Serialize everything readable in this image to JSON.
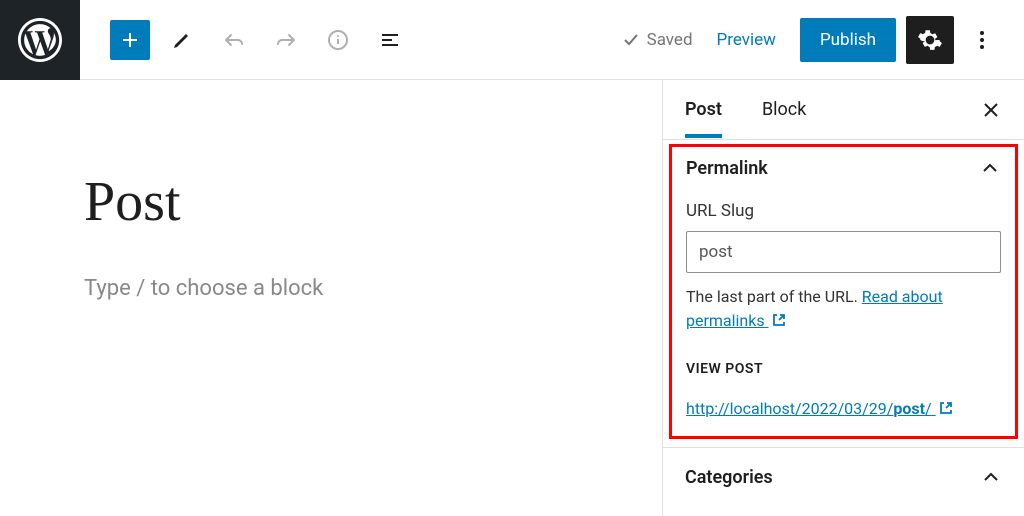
{
  "topbar": {
    "saved": "Saved",
    "preview": "Preview",
    "publish": "Publish"
  },
  "editor": {
    "title": "Post",
    "placeholder": "Type / to choose a block"
  },
  "tabs": {
    "post": "Post",
    "block": "Block"
  },
  "permalink": {
    "title": "Permalink",
    "slug_label": "URL Slug",
    "slug_value": "post",
    "help_prefix": "The last part of the URL. ",
    "help_link": "Read about permalinks",
    "view_label": "VIEW POST",
    "url_prefix": "http://localhost/2022/03/29/",
    "url_slug": "post",
    "url_suffix": "/"
  },
  "categories": {
    "title": "Categories"
  }
}
